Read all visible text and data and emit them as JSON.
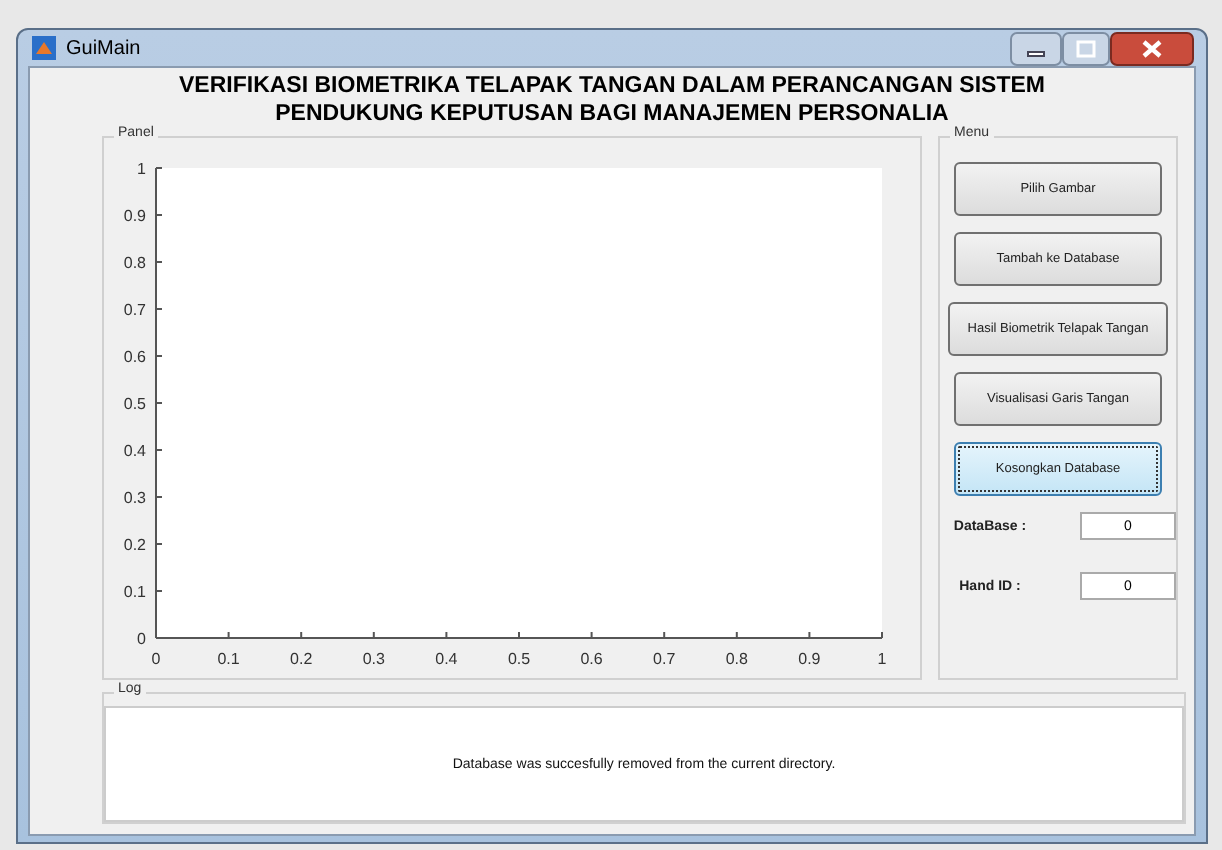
{
  "window": {
    "title": "GuiMain"
  },
  "heading": [
    "VERIFIKASI BIOMETRIKA TELAPAK TANGAN DALAM PERANCANGAN SISTEM",
    "PENDUKUNG KEPUTUSAN BAGI MANAJEMEN PERSONALIA"
  ],
  "panel": {
    "title": "Panel",
    "chart_data": {
      "type": "line",
      "xlim": [
        0,
        1
      ],
      "ylim": [
        0,
        1
      ],
      "xticks": [
        0,
        0.1,
        0.2,
        0.3,
        0.4,
        0.5,
        0.6,
        0.7,
        0.8,
        0.9,
        1
      ],
      "yticks": [
        0,
        0.1,
        0.2,
        0.3,
        0.4,
        0.5,
        0.6,
        0.7,
        0.8,
        0.9,
        1
      ]
    }
  },
  "menu": {
    "title": "Menu",
    "buttons": [
      {
        "label": "Pilih Gambar",
        "focused": false
      },
      {
        "label": "Tambah ke Database",
        "focused": false
      },
      {
        "label": "Hasil Biometrik Telapak Tangan",
        "focused": false
      },
      {
        "label": "Visualisasi Garis Tangan",
        "focused": false
      },
      {
        "label": "Kosongkan Database",
        "focused": true
      }
    ],
    "fields": [
      {
        "label": "DataBase :",
        "value": "0"
      },
      {
        "label": "Hand ID :",
        "value": "0"
      }
    ]
  },
  "log": {
    "title": "Log",
    "message": "Database was succesfully removed from the current directory."
  }
}
